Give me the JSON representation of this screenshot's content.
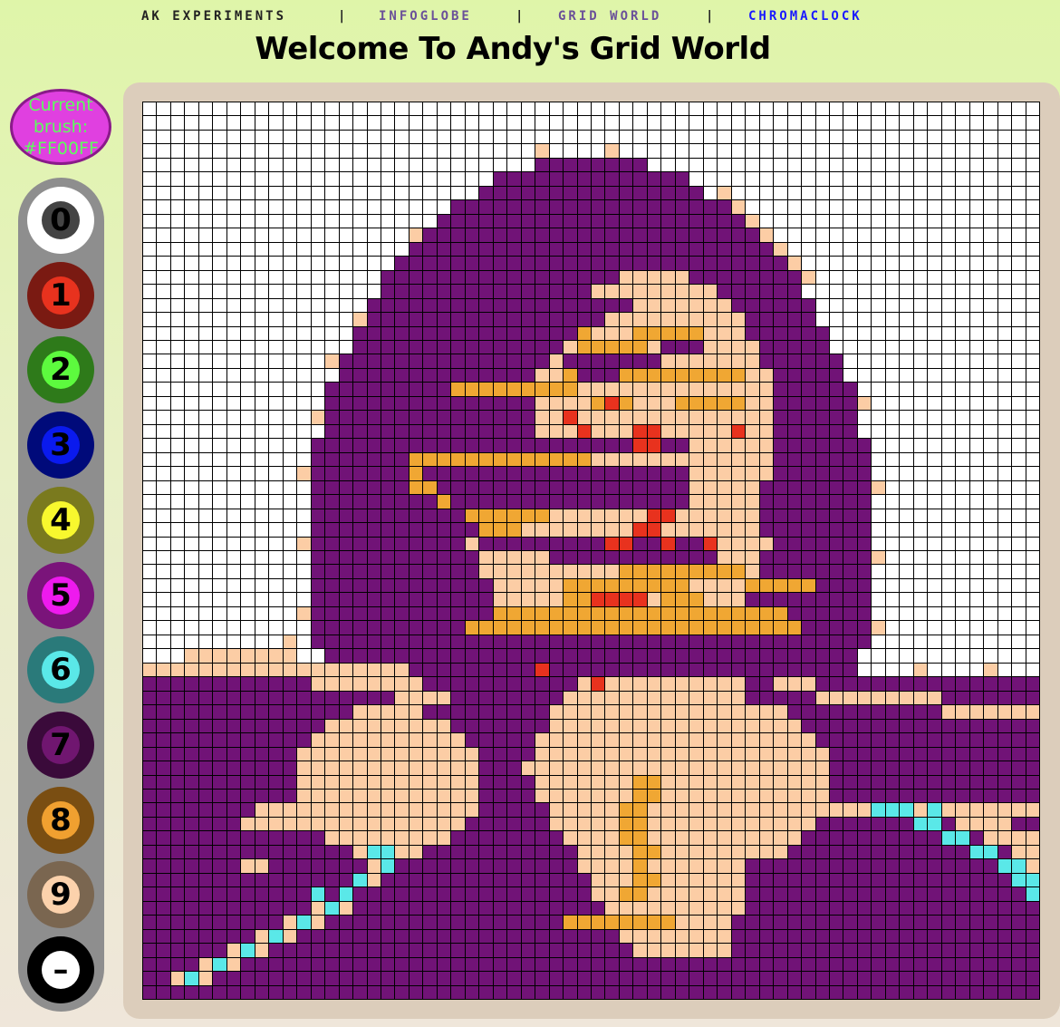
{
  "nav": {
    "items": [
      {
        "label": "AK EXPERIMENTS",
        "color": "#222222"
      },
      {
        "label": "INFOGLOBE",
        "color": "#6a5099"
      },
      {
        "label": "GRID WORLD",
        "color": "#6a5099"
      },
      {
        "label": "CHROMACLOCK",
        "color": "#1a1aff"
      }
    ],
    "separator": "|"
  },
  "page": {
    "title": "Welcome To Andy's Grid World"
  },
  "brush": {
    "line1": "Current",
    "line2": "brush:",
    "value": "#FF00FF",
    "bg_color": "#e040e0",
    "border_color": "#8a1a8a"
  },
  "palette": [
    {
      "digit": "0",
      "outer": "#ffffff",
      "inner": "#444444",
      "label_color": "#000000"
    },
    {
      "digit": "1",
      "outer": "#7a1a12",
      "inner": "#e8321e",
      "label_color": "#000000"
    },
    {
      "digit": "2",
      "outer": "#2e7a1a",
      "inner": "#5dfa3e",
      "label_color": "#000000"
    },
    {
      "digit": "3",
      "outer": "#000a7a",
      "inner": "#0a1aee",
      "label_color": "#000000"
    },
    {
      "digit": "4",
      "outer": "#7a7a1e",
      "inner": "#f8f82e",
      "label_color": "#000000"
    },
    {
      "digit": "5",
      "outer": "#7a147a",
      "inner": "#ee1aee",
      "label_color": "#000000"
    },
    {
      "digit": "6",
      "outer": "#2a7a7a",
      "inner": "#5ae8e8",
      "label_color": "#000000"
    },
    {
      "digit": "7",
      "outer": "#3a0a3a",
      "inner": "#701670",
      "label_color": "#000000"
    },
    {
      "digit": "8",
      "outer": "#7a4e12",
      "inner": "#f0a030",
      "label_color": "#000000"
    },
    {
      "digit": "9",
      "outer": "#7a6650",
      "inner": "#fcd2ac",
      "label_color": "#000000"
    },
    {
      "digit": "–",
      "outer": "#000000",
      "inner": "#ffffff",
      "label_color": "#000000"
    }
  ],
  "grid": {
    "size": 64,
    "colors": {
      "W": "#ffffff",
      "P": "#711377",
      "S": "#fccda5",
      "O": "#f0a733",
      "R": "#e8321e",
      "C": "#5ae8e8",
      "B": "#000000"
    }
  }
}
